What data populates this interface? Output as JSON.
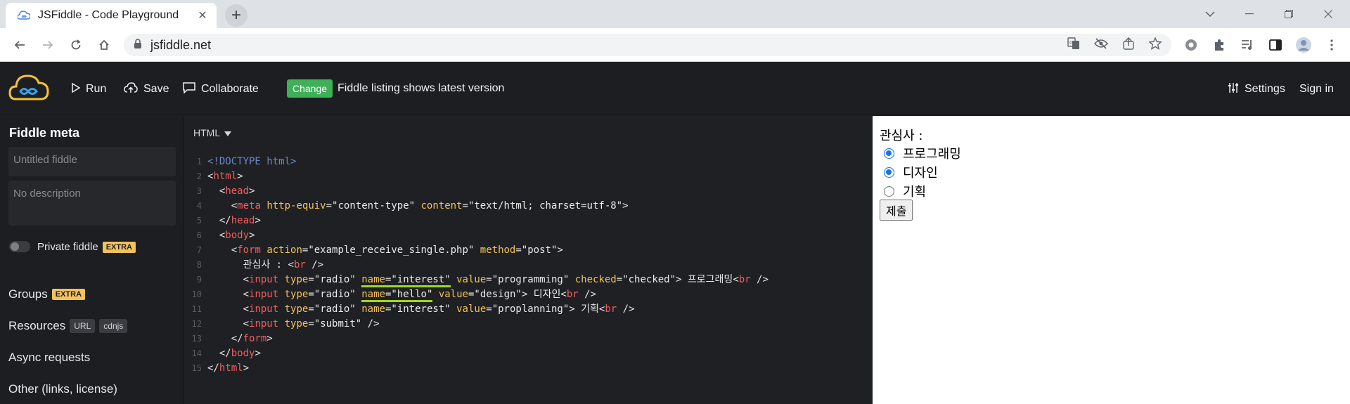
{
  "browser": {
    "tab_title": "JSFiddle - Code Playground",
    "url": "jsfiddle.net"
  },
  "header": {
    "run_label": "Run",
    "save_label": "Save",
    "collaborate_label": "Collaborate",
    "change_label": "Change",
    "listing_text": "Fiddle listing shows latest version",
    "settings_label": "Settings",
    "signin_label": "Sign in"
  },
  "sidebar": {
    "title": "Fiddle meta",
    "title_placeholder": "Untitled fiddle",
    "description_placeholder": "No description",
    "private_label": "Private fiddle",
    "extra_badge": "EXTRA",
    "groups_label": "Groups",
    "resources_label": "Resources",
    "url_badge": "URL",
    "cdnjs_badge": "cdnjs",
    "async_label": "Async requests",
    "other_label": "Other (links, license)"
  },
  "editor": {
    "language": "HTML",
    "line_numbers": [
      "1",
      "2",
      "3",
      "4",
      "5",
      "6",
      "7",
      "8",
      "9",
      "10",
      "11",
      "12",
      "13",
      "14",
      "15"
    ],
    "tokens": {
      "doctype": "<!DOCTYPE html>",
      "html": "html",
      "head": "head",
      "meta": "meta",
      "body": "body",
      "form": "form",
      "input": "input",
      "br": "br",
      "attr_http_equiv": "http-equiv",
      "attr_content": "content",
      "attr_action": "action",
      "attr_method": "method",
      "attr_type": "type",
      "attr_name": "name",
      "attr_value": "value",
      "attr_checked": "checked",
      "str_content_type": "\"content-type\"",
      "str_text_html": "\"text/html; charset=utf-8\"",
      "str_action": "\"example_receive_single.php\"",
      "str_post": "\"post\"",
      "str_radio": "\"radio\"",
      "str_interest": "\"interest\"",
      "str_hello": "\"hello\"",
      "str_programming": "\"programming\"",
      "str_checked": "\"checked\"",
      "str_design": "\"design\"",
      "str_proplanning": "\"proplanning\"",
      "str_submit": "\"submit\"",
      "text_interest": "관심사 : ",
      "text_programming": " 프로그래밍",
      "text_design": " 디자인",
      "text_planning": " 기획"
    }
  },
  "result": {
    "label": "관심사 :",
    "options": [
      {
        "label": "프로그래밍",
        "checked": true
      },
      {
        "label": "디자인",
        "checked": true
      },
      {
        "label": "기획",
        "checked": false
      }
    ],
    "submit_label": "제출"
  },
  "colors": {
    "accent_change": "#3eb058",
    "extra_badge": "#f3c25a",
    "underline_highlight": "#a0d81d",
    "radio_checked": "#1a73e8"
  }
}
